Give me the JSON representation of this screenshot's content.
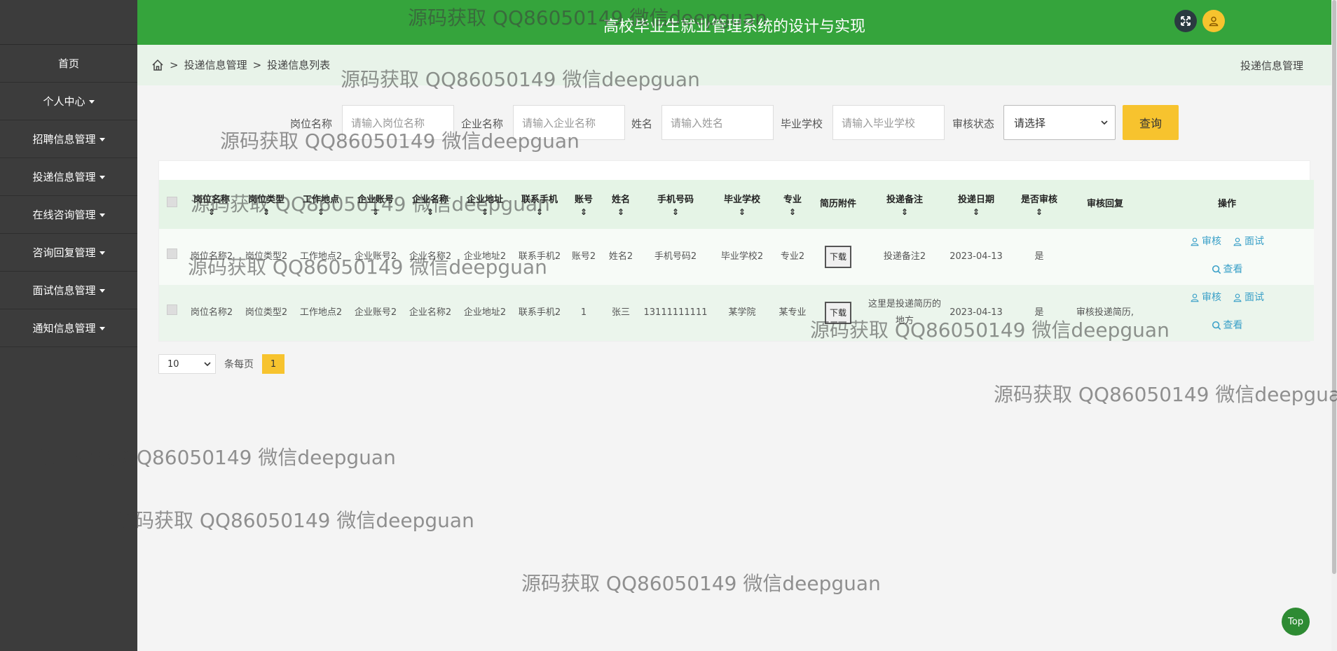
{
  "app": {
    "title": "高校毕业生就业管理系统的设计与实现"
  },
  "sidebar": {
    "items": [
      {
        "label": "首页",
        "has_caret": false
      },
      {
        "label": "个人中心",
        "has_caret": true
      },
      {
        "label": "招聘信息管理",
        "has_caret": true
      },
      {
        "label": "投递信息管理",
        "has_caret": true
      },
      {
        "label": "在线咨询管理",
        "has_caret": true
      },
      {
        "label": "咨询回复管理",
        "has_caret": true
      },
      {
        "label": "面试信息管理",
        "has_caret": true
      },
      {
        "label": "通知信息管理",
        "has_caret": true
      }
    ]
  },
  "breadcrumb": {
    "sep": ">",
    "level1": "投递信息管理",
    "level2": "投递信息列表",
    "right": "投递信息管理"
  },
  "search": {
    "fields": [
      {
        "label": "岗位名称",
        "placeholder": "请输入岗位名称"
      },
      {
        "label": "企业名称",
        "placeholder": "请输入企业名称"
      },
      {
        "label": "姓名",
        "placeholder": "请输入姓名"
      },
      {
        "label": "毕业学校",
        "placeholder": "请输入毕业学校"
      }
    ],
    "status_label": "审核状态",
    "status_value": "请选择",
    "query_button": "查询"
  },
  "table": {
    "columns": [
      "岗位名称",
      "岗位类型",
      "工作地点",
      "企业账号",
      "企业名称",
      "企业地址",
      "联系手机",
      "账号",
      "姓名",
      "手机号码",
      "毕业学校",
      "专业",
      "简历附件",
      "投递备注",
      "投递日期",
      "是否审核",
      "审核回复",
      "操作"
    ],
    "rows": [
      {
        "cells": [
          "岗位名称2",
          "岗位类型2",
          "工作地点2",
          "企业账号2",
          "企业名称2",
          "企业地址2",
          "联系手机2",
          "账号2",
          "姓名2",
          "手机号码2",
          "毕业学校2",
          "专业2",
          "",
          "投递备注2",
          "2023-04-13",
          "是",
          ""
        ]
      },
      {
        "cells": [
          "岗位名称2",
          "岗位类型2",
          "工作地点2",
          "企业账号2",
          "企业名称2",
          "企业地址2",
          "联系手机2",
          "1",
          "张三",
          "13111111111",
          "某学院",
          "某专业",
          "",
          "这里是投递简历的地方",
          "2023-04-13",
          "是",
          "审核投递简历,"
        ]
      }
    ],
    "download_label": "下载",
    "actions": {
      "review": "审核",
      "interview": "面试",
      "view": "查看"
    }
  },
  "pager": {
    "page_size": "10",
    "per_page_label": "条每页",
    "current_page": "1"
  },
  "top_button": "Top",
  "watermark": "源码获取 QQ86050149 微信deepguan",
  "colors": {
    "header": "#35a43c",
    "sidebar": "#3c3c3c",
    "accent": "#f7c32e",
    "link": "#3aa0c8"
  }
}
